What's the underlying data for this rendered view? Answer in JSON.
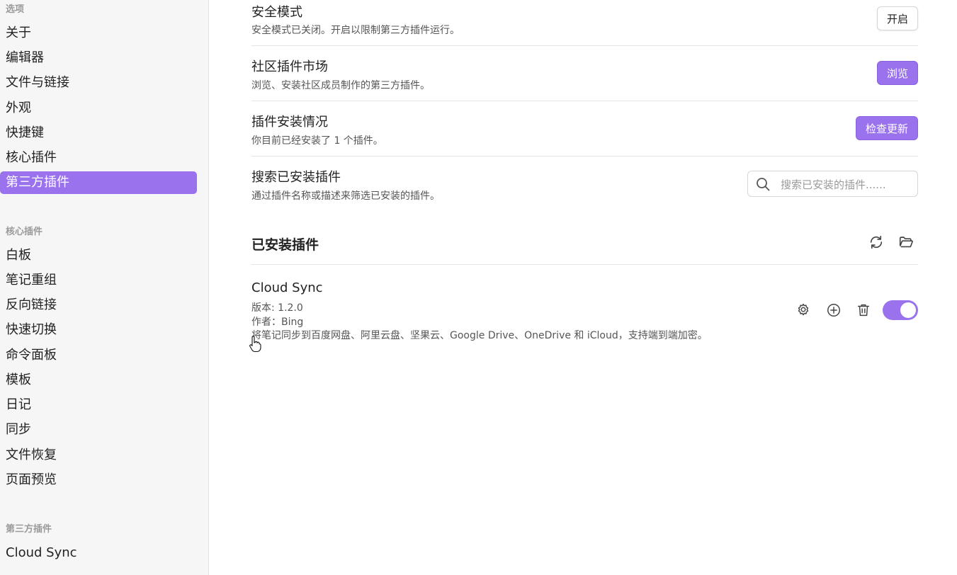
{
  "sidebar": {
    "options_heading": "选项",
    "options": [
      "关于",
      "编辑器",
      "文件与链接",
      "外观",
      "快捷键",
      "核心插件",
      "第三方插件"
    ],
    "active_index": 6,
    "core_heading": "核心插件",
    "core": [
      "白板",
      "笔记重组",
      "反向链接",
      "快速切换",
      "命令面板",
      "模板",
      "日记",
      "同步",
      "文件恢复",
      "页面预览"
    ],
    "third_heading": "第三方插件",
    "third": [
      "Cloud Sync"
    ]
  },
  "settings": {
    "safe_mode": {
      "title": "安全模式",
      "desc": "安全模式已关闭。开启以限制第三方插件运行。",
      "button": "开启"
    },
    "community": {
      "title": "社区插件市场",
      "desc": "浏览、安装社区成员制作的第三方插件。",
      "button": "浏览"
    },
    "installed_status": {
      "title": "插件安装情况",
      "desc": "你目前已经安装了 1 个插件。",
      "button": "检查更新"
    },
    "search": {
      "title": "搜索已安装插件",
      "desc": "通过插件名称或描述来筛选已安装的插件。",
      "placeholder": "搜索已安装的插件......"
    }
  },
  "installed": {
    "heading": "已安装插件",
    "plugins": [
      {
        "name": "Cloud Sync",
        "version": "版本: 1.2.0",
        "author": "作者：Bing",
        "desc": "将笔记同步到百度网盘、阿里云盘、坚果云、Google Drive、OneDrive 和 iCloud，支持端到端加密。",
        "enabled": true
      }
    ]
  },
  "icons": {
    "reload": "reload-icon",
    "open_folder": "folder-open-icon",
    "settings": "gear-icon",
    "hotkeys": "plus-circle-icon",
    "uninstall": "trash-icon",
    "search": "search-icon"
  },
  "colors": {
    "accent": "#9b72ee",
    "sidebar_bg": "#f6f6f6"
  }
}
